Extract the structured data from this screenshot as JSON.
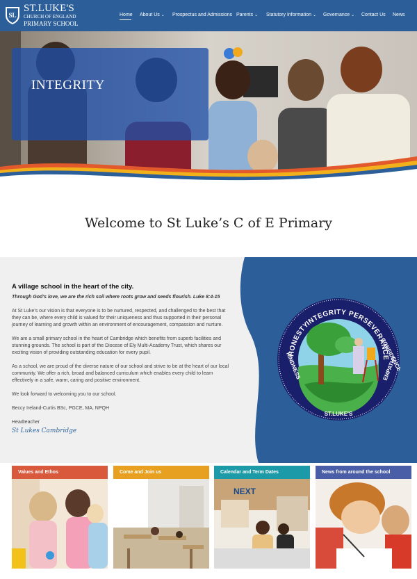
{
  "site": {
    "logo_line1": "ST.LUKE'S",
    "logo_line2": "CHURCH OF ENGLAND",
    "logo_line3": "PRIMARY SCHOOL"
  },
  "nav": {
    "items": [
      {
        "label": "Home",
        "has_menu": false
      },
      {
        "label": "About Us",
        "has_menu": true
      },
      {
        "label": "Prospectus and Admissions",
        "has_menu": false
      },
      {
        "label": "Parents",
        "has_menu": true
      },
      {
        "label": "Statutory Information",
        "has_menu": true
      },
      {
        "label": "Governance",
        "has_menu": true
      },
      {
        "label": "Contact Us",
        "has_menu": false
      },
      {
        "label": "News",
        "has_menu": false
      }
    ],
    "caret": "⌄"
  },
  "hero": {
    "title": "INTEGRITY"
  },
  "welcome": {
    "heading": "Welcome to St Luke’s C of E Primary"
  },
  "intro": {
    "heading": "A village school in the heart of the city.",
    "verse": "Through God’s love, we are the rich soil where roots grow and seeds flourish. Luke 8:4-15",
    "paragraphs": [
      "At St Luke’s our vision is that everyone is to be nurtured, respected, and challenged to the best that they can be, where every child is valued for their uniqueness and thus supported in their personal journey of learning and growth within an environment of encouragement, compassion and nurture.",
      "We are a small primary school in the heart of Cambridge which benefits from superb facilities and stunning grounds. The school is part of the Diocese of Ely Multi-Academy Trust, which shares our exciting vision of providing outstanding education for every pupil.",
      "As a school, we are proud of the diverse nature of our school and strive to be at the heart of our local community. We offer a rich, broad and balanced curriculum which enables every child to learn effectively in a safe, warm, caring and positive environment.",
      "We look forward to welcoming you to our school.",
      "Beccy Ireland-Curtis BSc, PGCE, MA, NPQH"
    ],
    "role": "Headteacher",
    "signature": "St Lukes Cambridge"
  },
  "mosaic": {
    "words": [
      "INTEGRITY",
      "PERSEVERANCE",
      "CONFIDENCE",
      "EMPATHY",
      "KINDNESS",
      "HONESTY",
      "ST.LUKE'S"
    ]
  },
  "cards": [
    {
      "label": "Values and Ethos",
      "color": "#d9593c"
    },
    {
      "label": "Come and Join us",
      "color": "#e8a020"
    },
    {
      "label": "Calendar and Term Dates",
      "color": "#1d9aa8"
    },
    {
      "label": "News from around the school",
      "color": "#4a5ea8"
    }
  ],
  "colors": {
    "brand_blue": "#2c5f99"
  }
}
